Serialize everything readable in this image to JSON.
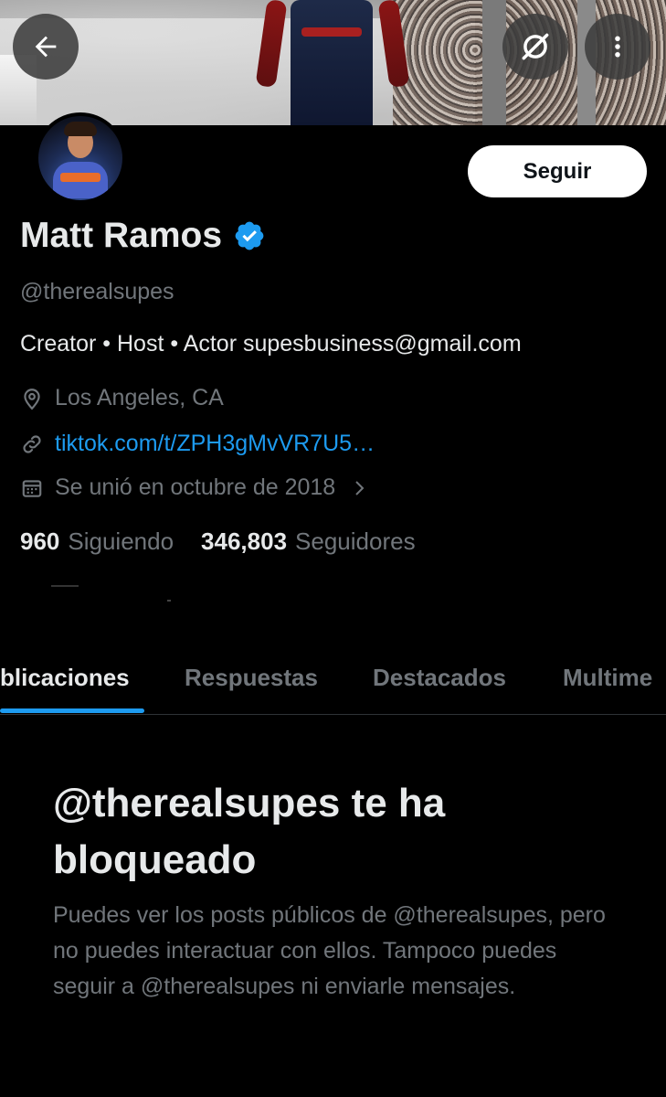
{
  "header": {
    "back_icon": "arrow-left-icon",
    "grok_icon": "grok-icon",
    "more_icon": "more-vertical-icon"
  },
  "profile": {
    "name": "Matt Ramos",
    "verified": true,
    "handle": "@therealsupes",
    "follow_label": "Seguir",
    "bio": "Creator • Host • Actor supesbusiness@gmail.com",
    "location": "Los Angeles, CA",
    "website": "tiktok.com/t/ZPH3gMvVR7U5…",
    "joined": "Se unió en octubre de 2018",
    "following_count": "960",
    "following_label": "Siguiendo",
    "followers_count": "346,803",
    "followers_label": "Seguidores"
  },
  "tabs": [
    {
      "label": "blicaciones",
      "active": true
    },
    {
      "label": "Respuestas",
      "active": false
    },
    {
      "label": "Destacados",
      "active": false
    },
    {
      "label": "Multime",
      "active": false
    }
  ],
  "blocked": {
    "title": "@therealsupes te ha bloqueado",
    "description": "Puedes ver los posts públicos de @therealsupes, pero no puedes interactuar con ellos. Tampoco puedes seguir a @therealsupes ni enviarle mensajes."
  },
  "colors": {
    "background": "#000000",
    "accent": "#1d9bf0",
    "muted_text": "#71767b",
    "primary_text": "#e7e9ea"
  }
}
